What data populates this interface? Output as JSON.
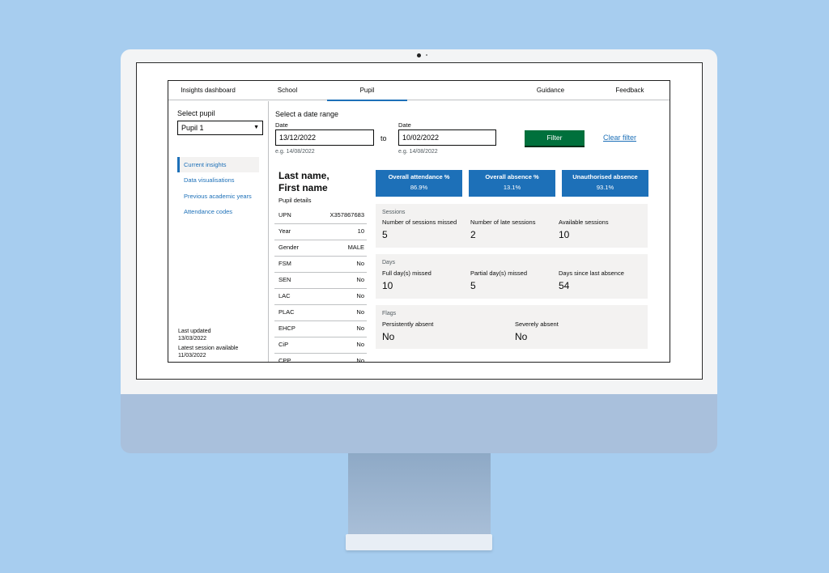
{
  "nav": {
    "items": [
      {
        "label": "Insights dashboard"
      },
      {
        "label": "School"
      },
      {
        "label": "Pupil"
      },
      {
        "label": "Guidance"
      },
      {
        "label": "Feedback"
      }
    ],
    "active": "Pupil"
  },
  "sidebar": {
    "select_label": "Select pupil",
    "select_value": "Pupil 1",
    "links": [
      {
        "label": "Current insights"
      },
      {
        "label": "Data visualisations"
      },
      {
        "label": "Previous academic years"
      },
      {
        "label": "Attendance codes"
      }
    ],
    "last_updated_label": "Last updated",
    "last_updated": "13/03/2022",
    "latest_session_label": "Latest session available",
    "latest_session": "11/03/2022"
  },
  "date_range": {
    "heading": "Select a date range",
    "from_label": "Date",
    "from_value": "13/12/2022",
    "from_hint": "e.g. 14/08/2022",
    "to_text": "to",
    "to_label": "Date",
    "to_value": "10/02/2022",
    "to_hint": "e.g. 14/08/2022",
    "filter_label": "Filter",
    "clear_label": "Clear filter"
  },
  "pupil": {
    "name_line1": "Last name,",
    "name_line2": "First name",
    "details_label": "Pupil details",
    "details": [
      {
        "k": "UPN",
        "v": "X357867683"
      },
      {
        "k": "Year",
        "v": "10"
      },
      {
        "k": "Gender",
        "v": "MALE"
      },
      {
        "k": "FSM",
        "v": "No"
      },
      {
        "k": "SEN",
        "v": "No"
      },
      {
        "k": "LAC",
        "v": "No"
      },
      {
        "k": "PLAC",
        "v": "No"
      },
      {
        "k": "EHCP",
        "v": "No"
      },
      {
        "k": "CiP",
        "v": "No"
      },
      {
        "k": "CPP",
        "v": "No"
      }
    ]
  },
  "tiles": [
    {
      "title": "Overall attendance %",
      "value": "86.9%"
    },
    {
      "title": "Overall absence %",
      "value": "13.1%"
    },
    {
      "title": "Unauthorised absence",
      "value": "93.1%"
    }
  ],
  "sessions": {
    "title": "Sessions",
    "items": [
      {
        "label": "Number of sessions missed",
        "value": "5"
      },
      {
        "label": "Number of late sessions",
        "value": "2"
      },
      {
        "label": "Available sessions",
        "value": "10"
      }
    ]
  },
  "days": {
    "title": "Days",
    "items": [
      {
        "label": "Full day(s) missed",
        "value": "10"
      },
      {
        "label": "Partial day(s) missed",
        "value": "5"
      },
      {
        "label": "Days since last absence",
        "value": "54"
      }
    ]
  },
  "flags": {
    "title": "Flags",
    "items": [
      {
        "label": "Persistently absent",
        "value": "No"
      },
      {
        "label": "Severely absent",
        "value": "No"
      }
    ]
  },
  "colors": {
    "accent": "#1d70b8",
    "filter": "#00703c",
    "background": "#a7cdef"
  }
}
